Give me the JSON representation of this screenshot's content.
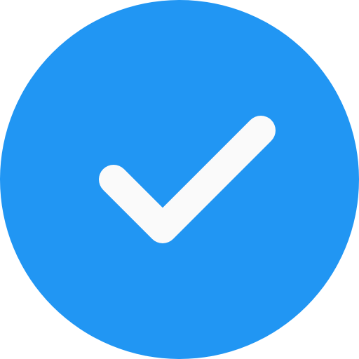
{
  "icon": {
    "name": "check-circle-icon",
    "circle_color": "#2196F3",
    "check_color": "#FAFAFA"
  }
}
